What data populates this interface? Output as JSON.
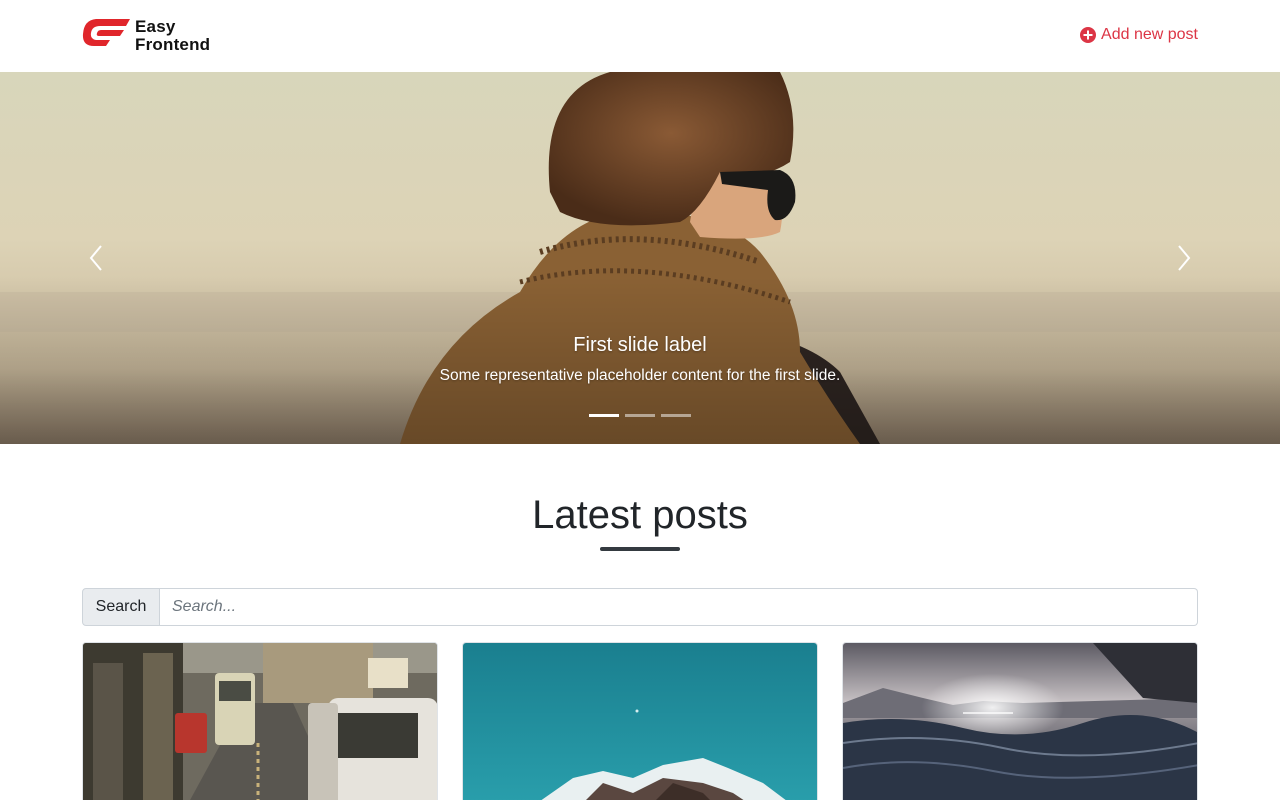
{
  "brand": {
    "line1": "Easy",
    "line2": "Frontend",
    "color": "#e0262b"
  },
  "nav": {
    "add_post_label": "Add new post",
    "add_post_icon": "plus-circle-icon",
    "accent": "#dc3545"
  },
  "carousel": {
    "slide_title": "First slide label",
    "slide_text": "Some representative placeholder content for the first slide.",
    "slide_count": 3,
    "active_index": 0,
    "prev_icon": "chevron-left-icon",
    "next_icon": "chevron-right-icon"
  },
  "posts": {
    "heading": "Latest posts",
    "search": {
      "label": "Search",
      "placeholder": "Search...",
      "value": ""
    }
  }
}
